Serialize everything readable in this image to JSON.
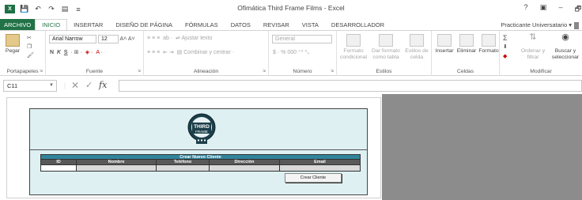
{
  "window": {
    "title": "Ofimática Third Frame Films - Excel",
    "controls": [
      "?",
      "▣",
      "–",
      "🗗"
    ]
  },
  "ribbon_tabs": [
    {
      "label": "ARCHIVO",
      "kind": "file"
    },
    {
      "label": "INICIO",
      "kind": "active"
    },
    {
      "label": "INSERTAR",
      "kind": "normal"
    },
    {
      "label": "DISEÑO DE PÁGINA",
      "kind": "normal"
    },
    {
      "label": "FÓRMULAS",
      "kind": "normal"
    },
    {
      "label": "DATOS",
      "kind": "normal"
    },
    {
      "label": "REVISAR",
      "kind": "normal"
    },
    {
      "label": "VISTA",
      "kind": "normal"
    },
    {
      "label": "DESARROLLADOR",
      "kind": "normal"
    }
  ],
  "user": "Practicante Universatario",
  "ribbon": {
    "clipboard": {
      "paste": "Pegar",
      "label": "Portapapeles"
    },
    "font": {
      "name": "Arial Narrow",
      "size": "12",
      "bold": "N",
      "italic": "K",
      "underline": "S",
      "label": "Fuente"
    },
    "alignment": {
      "wrap": "Ajustar texto",
      "merge": "Combinar y centrar",
      "label": "Alineación"
    },
    "number": {
      "format": "General",
      "currency": "$",
      "percent": "%",
      "thousands": "000",
      "label": "Número"
    },
    "styles": {
      "conditional": "Formato condicional",
      "as_table": "Dar formato como tabla",
      "cell_styles": "Estilos de celda",
      "label": "Estilos"
    },
    "cells": {
      "insert": "Insertar",
      "delete": "Eliminar",
      "format": "Formato",
      "label": "Celdas"
    },
    "editing": {
      "sort": "Ordenar y filtrar",
      "find": "Buscar y seleccionar",
      "label": "Modificar"
    }
  },
  "formula_bar": {
    "name_box": "C11",
    "fx": "fx",
    "content": ""
  },
  "form": {
    "logo_text": "THIRD FRAME",
    "table_title": "Crear Nuevo Cliente",
    "columns": [
      "ID",
      "Nombre",
      "Teléfono",
      "Dirección",
      "Email"
    ],
    "button": "Crear Cliente"
  },
  "colors": {
    "excel_green": "#217346",
    "banner_bg": "#def0f2",
    "table_header": "#31849b",
    "column_header": "#595959"
  }
}
